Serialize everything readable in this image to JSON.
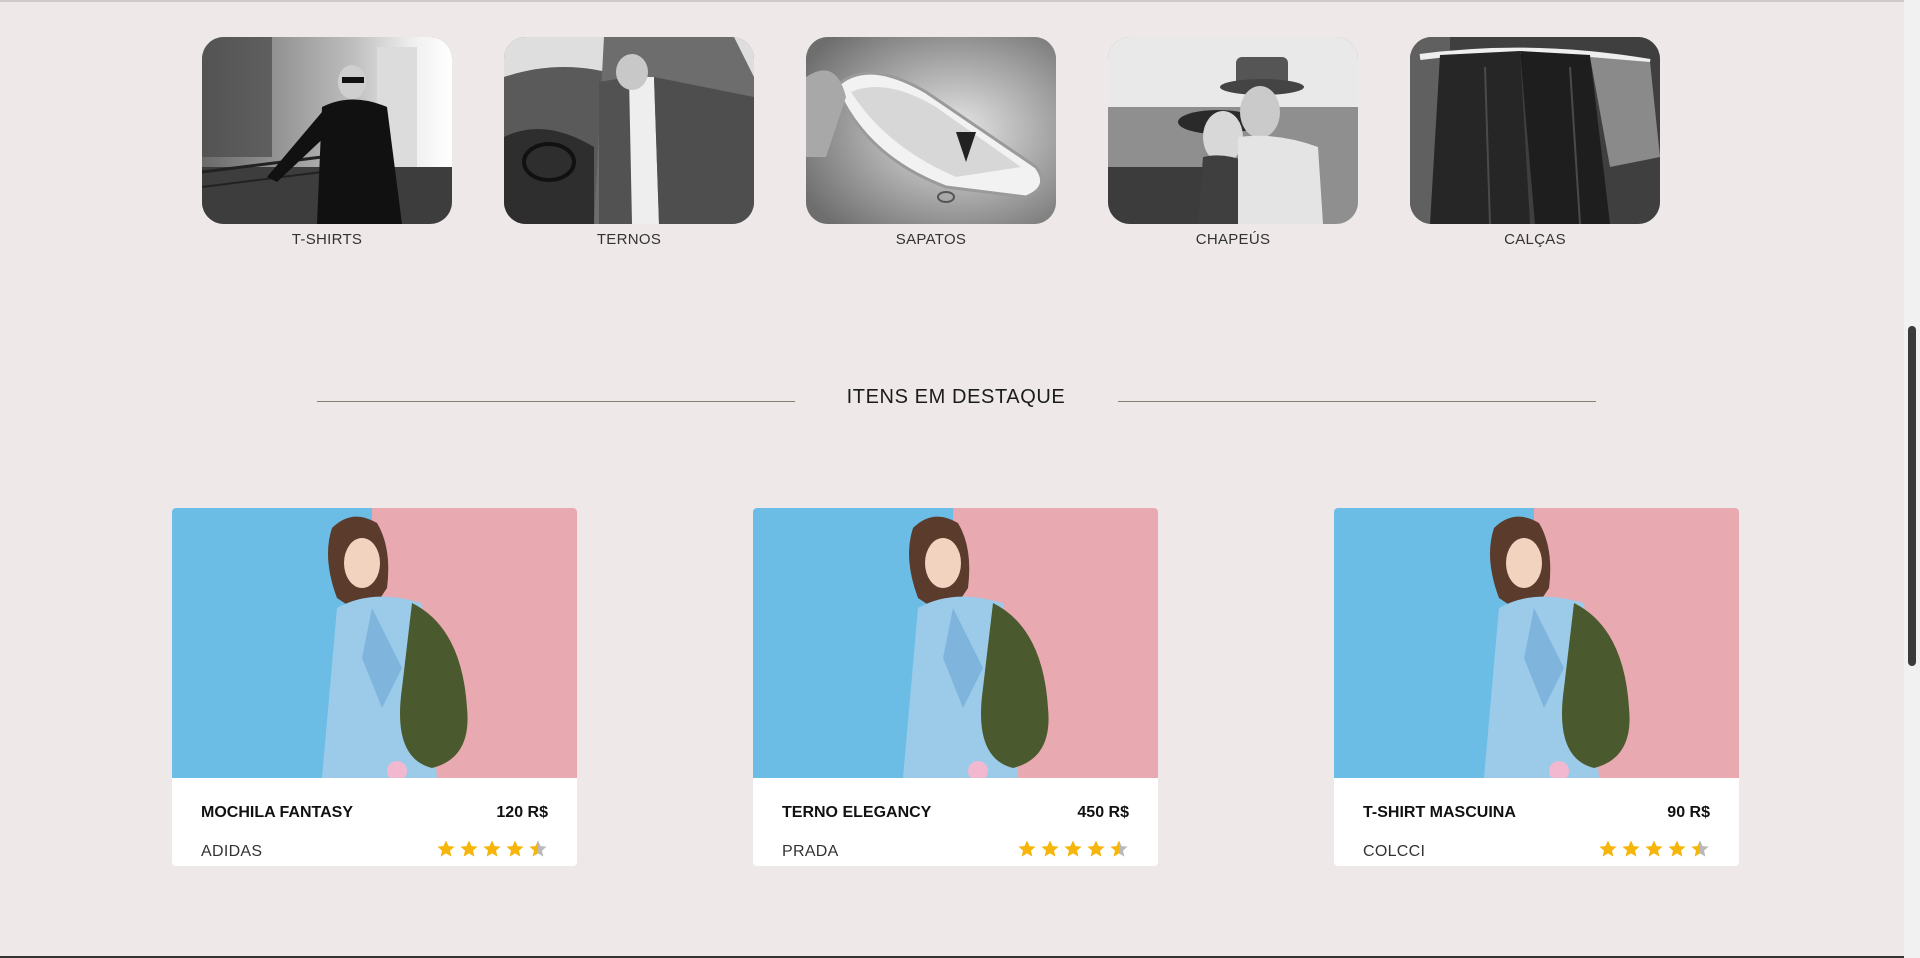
{
  "categories": [
    {
      "label": "T-SHIRTS"
    },
    {
      "label": "TERNOS"
    },
    {
      "label": "SAPATOS"
    },
    {
      "label": "CHAPEÚS"
    },
    {
      "label": "CALÇAS"
    }
  ],
  "featured": {
    "title": "ITENS EM DESTAQUE"
  },
  "products": [
    {
      "name": "MOCHILA FANTASY",
      "price": "120 R$",
      "brand": "ADIDAS",
      "rating": 4.5
    },
    {
      "name": "TERNO ELEGANCY",
      "price": "450 R$",
      "brand": "PRADA",
      "rating": 4.5
    },
    {
      "name": "T-SHIRT MASCUINA",
      "price": "90 R$",
      "brand": "COLCCI",
      "rating": 4.5
    }
  ],
  "colors": {
    "background": "#eee8e8",
    "star": "#f5b50a",
    "star_empty": "#b9b9b9",
    "photo_blue": "#6cbde6",
    "photo_pink": "#e8a9b0"
  },
  "icons": {
    "star": "star-icon"
  }
}
